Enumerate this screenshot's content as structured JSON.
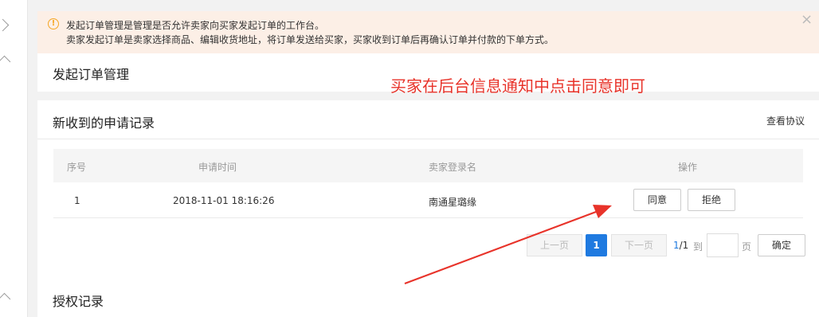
{
  "notice": {
    "line1": "发起订单管理是管理是否允许卖家向买家发起订单的工作台。",
    "line2": "卖家发起订单是卖家选择商品、编辑收货地址，将订单发送给买家，买家收到订单后再确认订单并付款的下单方式。",
    "icon": "info-icon",
    "close": "×"
  },
  "header": {
    "title": "发起订单管理"
  },
  "annotation": {
    "text": "买家在后台信息通知中点击同意即可",
    "color": "#e8332a"
  },
  "requests": {
    "title": "新收到的申请记录",
    "view_agreement": "查看协议",
    "columns": [
      "序号",
      "申请时间",
      "卖家登录名",
      "操作"
    ],
    "rows": [
      {
        "index": "1",
        "time": "2018-11-01 18:16:26",
        "seller": "南通星璐缘",
        "agree": "同意",
        "reject": "拒绝"
      }
    ]
  },
  "pager": {
    "prev": "上一页",
    "current": "1",
    "next": "下一页",
    "count_current": "1",
    "count_total": "/1",
    "to": "到",
    "page": "页",
    "confirm": "确定"
  },
  "auth": {
    "title": "授权记录"
  },
  "colors": {
    "accent": "#1f7ae0",
    "notice_bg": "#fcefe6",
    "annotation": "#e8332a"
  }
}
